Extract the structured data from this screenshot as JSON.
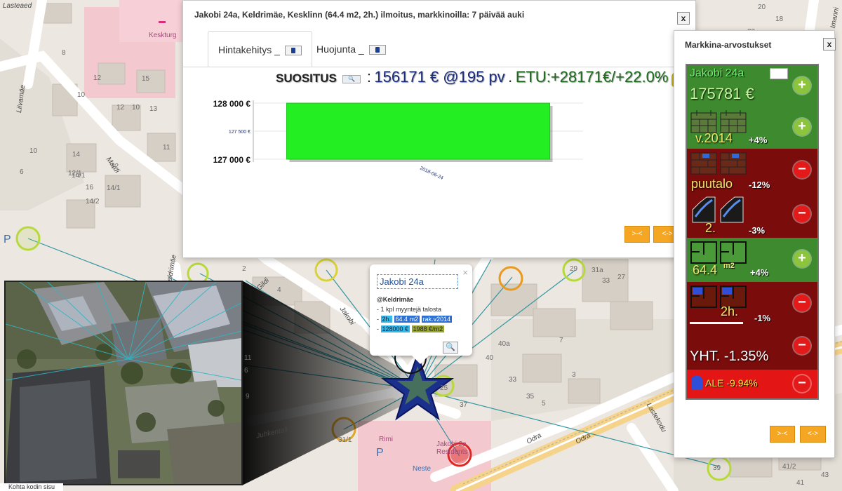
{
  "listing_window": {
    "title": "Jakobi 24a, Keldrimäe, Kesklinn (64.4 m2, 2h.) ilmoitus, markkinoilla: 7 päivää auki",
    "close_label": "x",
    "tabs": [
      {
        "label": "Hintakehitys _",
        "active": true
      },
      {
        "label": "Huojunta _",
        "active": false
      }
    ],
    "suositus": {
      "label": "SUOSITUS",
      "button_label": "🔍",
      "colon": ":",
      "price_text": "156171 € @195 pv",
      "separator": ".",
      "etu_text": "ETU:+28171€/+22.0%",
      "bag_label": "€"
    },
    "nav_prev": ">-<",
    "nav_next": "<->"
  },
  "chart_data": {
    "type": "bar",
    "categories": [
      "2018-06-24"
    ],
    "series": [
      {
        "values": [
          128000
        ]
      }
    ],
    "ylim": [
      127000,
      128000
    ],
    "yticks": [
      {
        "value": 127000,
        "label": "127 000 €"
      },
      {
        "value": 127500,
        "label": "127 500 €"
      },
      {
        "value": 128000,
        "label": "128 000 €"
      }
    ],
    "title": "",
    "xlabel": "",
    "ylabel": "",
    "bar_color": "#22ee22"
  },
  "market_window": {
    "title": "Markkina-arvostukset",
    "close_label": "x",
    "address": "Jakobi 24a",
    "value": "175781 €",
    "rows": [
      {
        "big": "v.2014",
        "small": "+4%",
        "sign": "+",
        "color": "#3d8b2e"
      },
      {
        "big": "puutalo",
        "small": "-12%",
        "sign": "-",
        "color": "#7a0c0c"
      },
      {
        "big": "2.",
        "small": "-3%",
        "sign": "-",
        "color": "#7a0c0c"
      },
      {
        "big": "64.4",
        "sup": "m2",
        "small": "+4%",
        "sign": "+",
        "color": "#3d8b2e"
      },
      {
        "big": "2h.",
        "small": "-1%",
        "sign": "-",
        "color": "#7a0c0c"
      }
    ],
    "total": "YHT. -1.35%",
    "ale": "ALE -9.94%",
    "nav_prev": ">-<",
    "nav_next": "<->"
  },
  "popup": {
    "title": "Jakobi 24a",
    "close": "×",
    "district": "@Keldrimäe",
    "line1": "- 1 kpl myyntejä talosta",
    "line2_prefix": "-",
    "line2_rooms": "2h.",
    "line2_area": "64.4 m2",
    "line2_year": "rak.v2014",
    "line3_prefix": "-",
    "line3_price": "128000 €",
    "line3_sqm": "1988 €/m2",
    "zoom_label": "🔍"
  },
  "map": {
    "streets": [
      "Liivamäe",
      "Mardi",
      "Gildi",
      "Jakobi",
      "Juhkentali",
      "Odra",
      "Odra",
      "Lastekodu",
      "Keldrimäe",
      "Imanni",
      "Lasteaed"
    ],
    "pois": [
      "Keskturg",
      "Rimi",
      "Neste",
      "Jakobi 2a Residents"
    ],
    "parking": "P",
    "house_numbers": [
      "12",
      "10",
      "8",
      "10",
      "12",
      "6",
      "14/1",
      "16",
      "14/2",
      "14",
      "10",
      "15",
      "13",
      "11",
      "12",
      "12/1",
      "14/1",
      "2",
      "4",
      "6",
      "11",
      "9",
      "7",
      "5",
      "3",
      "40a",
      "40",
      "29",
      "33",
      "31a",
      "27",
      "37",
      "25",
      "33",
      "35",
      "31/1",
      "39",
      "41/2",
      "41",
      "43",
      "20",
      "18",
      "22"
    ],
    "aerial_caption": "Kohta kodin sisu"
  }
}
